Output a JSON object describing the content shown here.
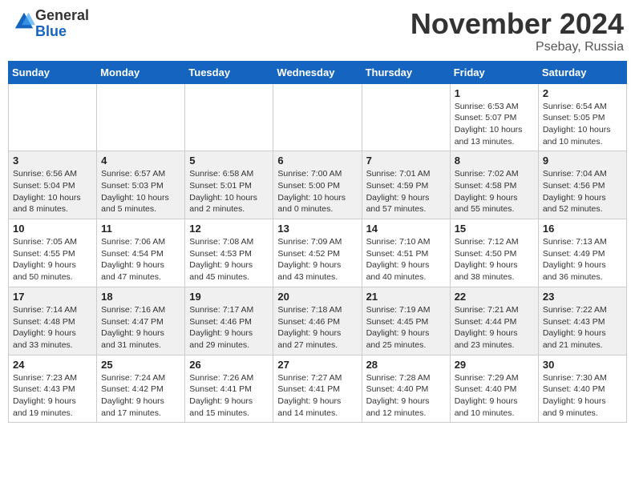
{
  "logo": {
    "general": "General",
    "blue": "Blue"
  },
  "title": "November 2024",
  "subtitle": "Psebay, Russia",
  "days_header": [
    "Sunday",
    "Monday",
    "Tuesday",
    "Wednesday",
    "Thursday",
    "Friday",
    "Saturday"
  ],
  "weeks": [
    [
      {
        "day": "",
        "info": ""
      },
      {
        "day": "",
        "info": ""
      },
      {
        "day": "",
        "info": ""
      },
      {
        "day": "",
        "info": ""
      },
      {
        "day": "",
        "info": ""
      },
      {
        "day": "1",
        "info": "Sunrise: 6:53 AM\nSunset: 5:07 PM\nDaylight: 10 hours and 13 minutes."
      },
      {
        "day": "2",
        "info": "Sunrise: 6:54 AM\nSunset: 5:05 PM\nDaylight: 10 hours and 10 minutes."
      }
    ],
    [
      {
        "day": "3",
        "info": "Sunrise: 6:56 AM\nSunset: 5:04 PM\nDaylight: 10 hours and 8 minutes."
      },
      {
        "day": "4",
        "info": "Sunrise: 6:57 AM\nSunset: 5:03 PM\nDaylight: 10 hours and 5 minutes."
      },
      {
        "day": "5",
        "info": "Sunrise: 6:58 AM\nSunset: 5:01 PM\nDaylight: 10 hours and 2 minutes."
      },
      {
        "day": "6",
        "info": "Sunrise: 7:00 AM\nSunset: 5:00 PM\nDaylight: 10 hours and 0 minutes."
      },
      {
        "day": "7",
        "info": "Sunrise: 7:01 AM\nSunset: 4:59 PM\nDaylight: 9 hours and 57 minutes."
      },
      {
        "day": "8",
        "info": "Sunrise: 7:02 AM\nSunset: 4:58 PM\nDaylight: 9 hours and 55 minutes."
      },
      {
        "day": "9",
        "info": "Sunrise: 7:04 AM\nSunset: 4:56 PM\nDaylight: 9 hours and 52 minutes."
      }
    ],
    [
      {
        "day": "10",
        "info": "Sunrise: 7:05 AM\nSunset: 4:55 PM\nDaylight: 9 hours and 50 minutes."
      },
      {
        "day": "11",
        "info": "Sunrise: 7:06 AM\nSunset: 4:54 PM\nDaylight: 9 hours and 47 minutes."
      },
      {
        "day": "12",
        "info": "Sunrise: 7:08 AM\nSunset: 4:53 PM\nDaylight: 9 hours and 45 minutes."
      },
      {
        "day": "13",
        "info": "Sunrise: 7:09 AM\nSunset: 4:52 PM\nDaylight: 9 hours and 43 minutes."
      },
      {
        "day": "14",
        "info": "Sunrise: 7:10 AM\nSunset: 4:51 PM\nDaylight: 9 hours and 40 minutes."
      },
      {
        "day": "15",
        "info": "Sunrise: 7:12 AM\nSunset: 4:50 PM\nDaylight: 9 hours and 38 minutes."
      },
      {
        "day": "16",
        "info": "Sunrise: 7:13 AM\nSunset: 4:49 PM\nDaylight: 9 hours and 36 minutes."
      }
    ],
    [
      {
        "day": "17",
        "info": "Sunrise: 7:14 AM\nSunset: 4:48 PM\nDaylight: 9 hours and 33 minutes."
      },
      {
        "day": "18",
        "info": "Sunrise: 7:16 AM\nSunset: 4:47 PM\nDaylight: 9 hours and 31 minutes."
      },
      {
        "day": "19",
        "info": "Sunrise: 7:17 AM\nSunset: 4:46 PM\nDaylight: 9 hours and 29 minutes."
      },
      {
        "day": "20",
        "info": "Sunrise: 7:18 AM\nSunset: 4:46 PM\nDaylight: 9 hours and 27 minutes."
      },
      {
        "day": "21",
        "info": "Sunrise: 7:19 AM\nSunset: 4:45 PM\nDaylight: 9 hours and 25 minutes."
      },
      {
        "day": "22",
        "info": "Sunrise: 7:21 AM\nSunset: 4:44 PM\nDaylight: 9 hours and 23 minutes."
      },
      {
        "day": "23",
        "info": "Sunrise: 7:22 AM\nSunset: 4:43 PM\nDaylight: 9 hours and 21 minutes."
      }
    ],
    [
      {
        "day": "24",
        "info": "Sunrise: 7:23 AM\nSunset: 4:43 PM\nDaylight: 9 hours and 19 minutes."
      },
      {
        "day": "25",
        "info": "Sunrise: 7:24 AM\nSunset: 4:42 PM\nDaylight: 9 hours and 17 minutes."
      },
      {
        "day": "26",
        "info": "Sunrise: 7:26 AM\nSunset: 4:41 PM\nDaylight: 9 hours and 15 minutes."
      },
      {
        "day": "27",
        "info": "Sunrise: 7:27 AM\nSunset: 4:41 PM\nDaylight: 9 hours and 14 minutes."
      },
      {
        "day": "28",
        "info": "Sunrise: 7:28 AM\nSunset: 4:40 PM\nDaylight: 9 hours and 12 minutes."
      },
      {
        "day": "29",
        "info": "Sunrise: 7:29 AM\nSunset: 4:40 PM\nDaylight: 9 hours and 10 minutes."
      },
      {
        "day": "30",
        "info": "Sunrise: 7:30 AM\nSunset: 4:40 PM\nDaylight: 9 hours and 9 minutes."
      }
    ]
  ]
}
